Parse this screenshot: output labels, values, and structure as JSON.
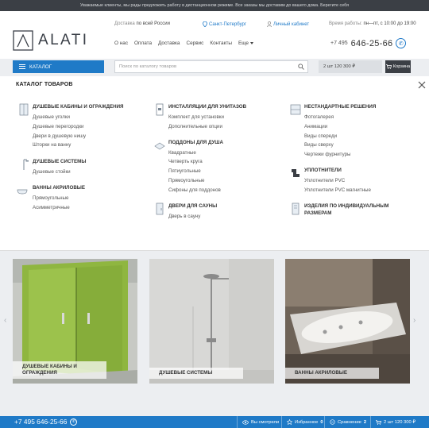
{
  "notice": "Уважаемые клиенты, мы рады предложить работу в дистанционном режиме. Все заказы мы доставим до вашего дома. Берегите себя",
  "brand": {
    "logo_text": "ALATI"
  },
  "header": {
    "delivery_prefix": "Доставка",
    "delivery_text": "по всей России",
    "city": "Санкт-Петербург",
    "account": "Личный кабинет",
    "hours_prefix": "Время работы:",
    "hours": "пн—пт, с 10:00 до 19:00",
    "phone_code": "+7 495",
    "phone_number": "646-25-66",
    "viber_icon": "viber-icon"
  },
  "nav": [
    {
      "label": "О нас"
    },
    {
      "label": "Оплата"
    },
    {
      "label": "Доставка"
    },
    {
      "label": "Сервис"
    },
    {
      "label": "Контакты"
    },
    {
      "label": "Еще"
    }
  ],
  "toolbar": {
    "catalog_label": "КАТАЛОГ",
    "search_placeholder": "Поиск по каталогу товаров",
    "cart_summary": "2 шт 120 300 ₽",
    "cart_label": "Корзина"
  },
  "catalog": {
    "title": "КАТАЛОГ ТОВАРОВ",
    "columns": [
      [
        {
          "title": "ДУШЕВЫЕ КАБИНЫ И ОГРАЖДЕНИЯ",
          "icon": "shower-cabin-icon",
          "items": [
            "Душевые уголки",
            "Душевые перегородки",
            "Двери в душевую нишу",
            "Шторки на ванну"
          ]
        },
        {
          "title": "ДУШЕВЫЕ СИСТЕМЫ",
          "icon": "shower-system-icon",
          "items": [
            "Душевые стойки"
          ]
        },
        {
          "title": "ВАННЫ АКРИЛОВЫЕ",
          "icon": "bathtub-icon",
          "items": [
            "Прямоугольные",
            "Асимметричные"
          ]
        }
      ],
      [
        {
          "title": "ИНСТАЛЛЯЦИИ ДЛЯ УНИТАЗОВ",
          "icon": "installation-icon",
          "items": [
            "Комплект для установки",
            "Дополнительные опции"
          ]
        },
        {
          "title": "ПОДДОНЫ ДЛЯ ДУША",
          "icon": "shower-tray-icon",
          "items": [
            "Квадратные",
            "Четверть круга",
            "Пятиугольные",
            "Прямоугольные",
            "Сифоны для поддонов"
          ]
        },
        {
          "title": "ДВЕРИ ДЛЯ САУНЫ",
          "icon": "sauna-door-icon",
          "items": [
            "Дверь в сауну"
          ]
        }
      ],
      [
        {
          "title": "НЕСТАНДАРТНЫЕ РЕШЕНИЯ",
          "icon": "custom-solutions-icon",
          "items": [
            "Фотогалерея",
            "Анимации",
            "Виды спереди",
            "Виды сверху",
            "Чертежи фурнитуры"
          ]
        },
        {
          "title": "УПЛОТНИТЕЛИ",
          "icon": "seal-icon",
          "items": [
            "Уплотнители PVC",
            "Уплотнители PVC магнитные"
          ]
        },
        {
          "title": "ИЗДЕЛИЯ ПО ИНДИВИДУАЛЬНЫМ РАЗМЕРАМ",
          "icon": "custom-size-icon",
          "items": []
        }
      ]
    ]
  },
  "cards": [
    {
      "label": "ДУШЕВЫЕ КАБИНЫ И ОГРАЖДЕНИЯ"
    },
    {
      "label": "ДУШЕВЫЕ СИСТЕМЫ"
    },
    {
      "label": "ВАННЫ АКРИЛОВЫЕ"
    }
  ],
  "footer": {
    "phone": "+7 495 646-25-66",
    "viewed_label": "Вы смотрели",
    "favorites_label": "Избранное",
    "favorites_count": "0",
    "compare_label": "Сравнение",
    "compare_count": "2",
    "cart_summary": "2 шт 120 300 ₽"
  },
  "colors": {
    "accent": "#1f7ac7",
    "dark": "#3b3f45",
    "background": "#eceef1"
  }
}
